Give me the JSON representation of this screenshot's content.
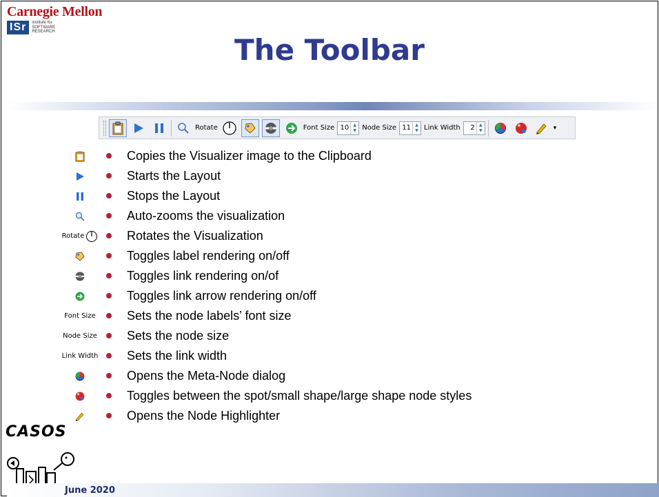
{
  "header": {
    "university": "Carnegie Mellon",
    "institute_mark": "ISr",
    "institute_lines": [
      "institute for",
      "SOFTWARE",
      "RESEARCH"
    ]
  },
  "title": "The Toolbar",
  "toolbar": {
    "rotate_label": "Rotate",
    "font_size_label": "Font Size",
    "font_size_value": "10",
    "node_size_label": "Node Size",
    "node_size_value": "11",
    "link_width_label": "Link Width",
    "link_width_value": "2",
    "dropdown_glyph": "▾"
  },
  "items": [
    {
      "icon_label": "",
      "text": "Copies the Visualizer image to the Clipboard"
    },
    {
      "icon_label": "",
      "text": "Starts the Layout"
    },
    {
      "icon_label": "",
      "text": "Stops the Layout"
    },
    {
      "icon_label": "",
      "text": "Auto-zooms the visualization"
    },
    {
      "icon_label": "Rotate",
      "text": "Rotates the Visualization"
    },
    {
      "icon_label": "",
      "text": "Toggles label rendering on/off"
    },
    {
      "icon_label": "",
      "text": "Toggles link rendering on/of"
    },
    {
      "icon_label": "",
      "text": "Toggles link arrow rendering on/off"
    },
    {
      "icon_label": "Font Size",
      "text": "Sets the node labels’ font size"
    },
    {
      "icon_label": "Node Size",
      "text": "Sets the node size"
    },
    {
      "icon_label": "Link Width",
      "text": "Sets the link width"
    },
    {
      "icon_label": "",
      "text": "Opens the Meta-Node dialog"
    },
    {
      "icon_label": "",
      "text": "Toggles between the spot/small shape/large shape node styles"
    },
    {
      "icon_label": "",
      "text": "Opens the Node Highlighter"
    }
  ],
  "footer": {
    "logo_text": "CASOS",
    "date": "June 2020"
  },
  "colors": {
    "title": "#2f3b8f",
    "bullet": "#b0243a",
    "cmu_red": "#b5121b",
    "isr_blue": "#1c4a8c"
  }
}
